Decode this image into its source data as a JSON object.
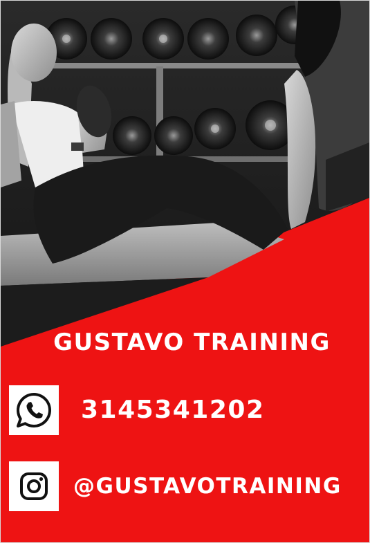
{
  "poster": {
    "title": "GUSTAVO TRAINING",
    "contacts": [
      {
        "icon": "whatsapp-icon",
        "value": "3145341202"
      },
      {
        "icon": "instagram-icon",
        "value": "@GUSTAVOTRAINING"
      }
    ]
  },
  "colors": {
    "background": "#ee1313",
    "text": "#ffffff",
    "icon_box": "#ffffff",
    "icon_glyph": "#111111"
  }
}
